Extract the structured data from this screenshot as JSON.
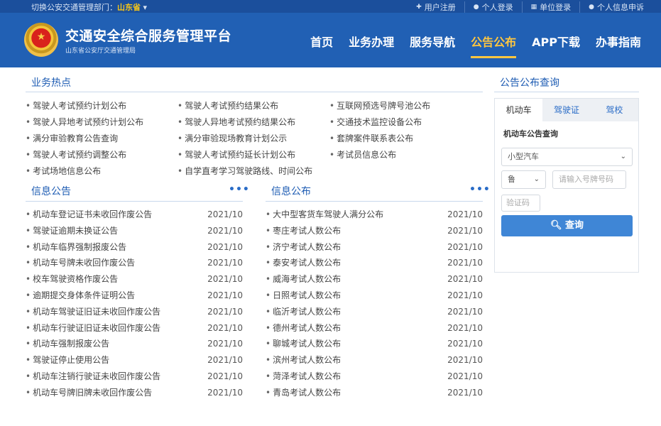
{
  "topbar": {
    "switch_label": "切换公安交通管理部门：",
    "province": "山东省",
    "links": [
      {
        "icon": "plus-icon",
        "label": "用户注册"
      },
      {
        "icon": "user-icon",
        "label": "个人登录"
      },
      {
        "icon": "building-icon",
        "label": "单位登录"
      },
      {
        "icon": "user-info-icon",
        "label": "个人信息申诉"
      }
    ]
  },
  "header": {
    "title": "交通安全综合服务管理平台",
    "subtitle": "山东省公安厅交通管理局",
    "nav": [
      "首页",
      "业务办理",
      "服务导航",
      "公告公布",
      "APP下载",
      "办事指南"
    ],
    "active_nav": "公告公布"
  },
  "hot": {
    "title": "业务热点",
    "items": [
      "驾驶人考试预约计划公布",
      "驾驶人考试预约结果公布",
      "互联网预选号牌号池公布",
      "驾驶人异地考试预约计划公布",
      "驾驶人异地考试预约结果公布",
      "交通技术监控设备公布",
      "满分审验教育公告查询",
      "满分审验现场教育计划公示",
      "套牌案件联系表公布",
      "驾驶人考试预约调整公布",
      "驾驶人考试预约延长计划公布",
      "考试员信息公布",
      "考试场地信息公布",
      "自学直考学习驾驶路线、时间公布"
    ]
  },
  "info_notice": {
    "title": "信息公告",
    "more": "•••",
    "rows": [
      {
        "title": "机动车登记证书未收回作废公告",
        "date": "2021/10"
      },
      {
        "title": "驾驶证逾期未换证公告",
        "date": "2021/10"
      },
      {
        "title": "机动车临界强制报废公告",
        "date": "2021/10"
      },
      {
        "title": "机动车号牌未收回作废公告",
        "date": "2021/10"
      },
      {
        "title": "校车驾驶资格作废公告",
        "date": "2021/10"
      },
      {
        "title": "逾期提交身体条件证明公告",
        "date": "2021/10"
      },
      {
        "title": "机动车驾驶证旧证未收回作废公告",
        "date": "2021/10"
      },
      {
        "title": "机动车行驶证旧证未收回作废公告",
        "date": "2021/10"
      },
      {
        "title": "机动车强制报废公告",
        "date": "2021/10"
      },
      {
        "title": "驾驶证停止使用公告",
        "date": "2021/10"
      },
      {
        "title": "机动车注销行驶证未收回作废公告",
        "date": "2021/10"
      },
      {
        "title": "机动车号牌旧牌未收回作废公告",
        "date": "2021/10"
      }
    ]
  },
  "info_publish": {
    "title": "信息公布",
    "more": "•••",
    "rows": [
      {
        "title": "大中型客货车驾驶人满分公布",
        "date": "2021/10"
      },
      {
        "title": "枣庄考试人数公布",
        "date": "2021/10"
      },
      {
        "title": "济宁考试人数公布",
        "date": "2021/10"
      },
      {
        "title": "泰安考试人数公布",
        "date": "2021/10"
      },
      {
        "title": "威海考试人数公布",
        "date": "2021/10"
      },
      {
        "title": "日照考试人数公布",
        "date": "2021/10"
      },
      {
        "title": "临沂考试人数公布",
        "date": "2021/10"
      },
      {
        "title": "德州考试人数公布",
        "date": "2021/10"
      },
      {
        "title": "聊城考试人数公布",
        "date": "2021/10"
      },
      {
        "title": "滨州考试人数公布",
        "date": "2021/10"
      },
      {
        "title": "菏泽考试人数公布",
        "date": "2021/10"
      },
      {
        "title": "青岛考试人数公布",
        "date": "2021/10"
      }
    ]
  },
  "query": {
    "title": "公告公布查询",
    "tabs": [
      "机动车",
      "驾驶证",
      "驾校"
    ],
    "active_tab": "机动车",
    "section_label": "机动车公告查询",
    "vehicle_type": "小型汽车",
    "province_prefix": "鲁",
    "plate_placeholder": "请输入号牌号码",
    "captcha_placeholder": "验证码",
    "search_icon": "search-icon",
    "search_label": "查询"
  }
}
